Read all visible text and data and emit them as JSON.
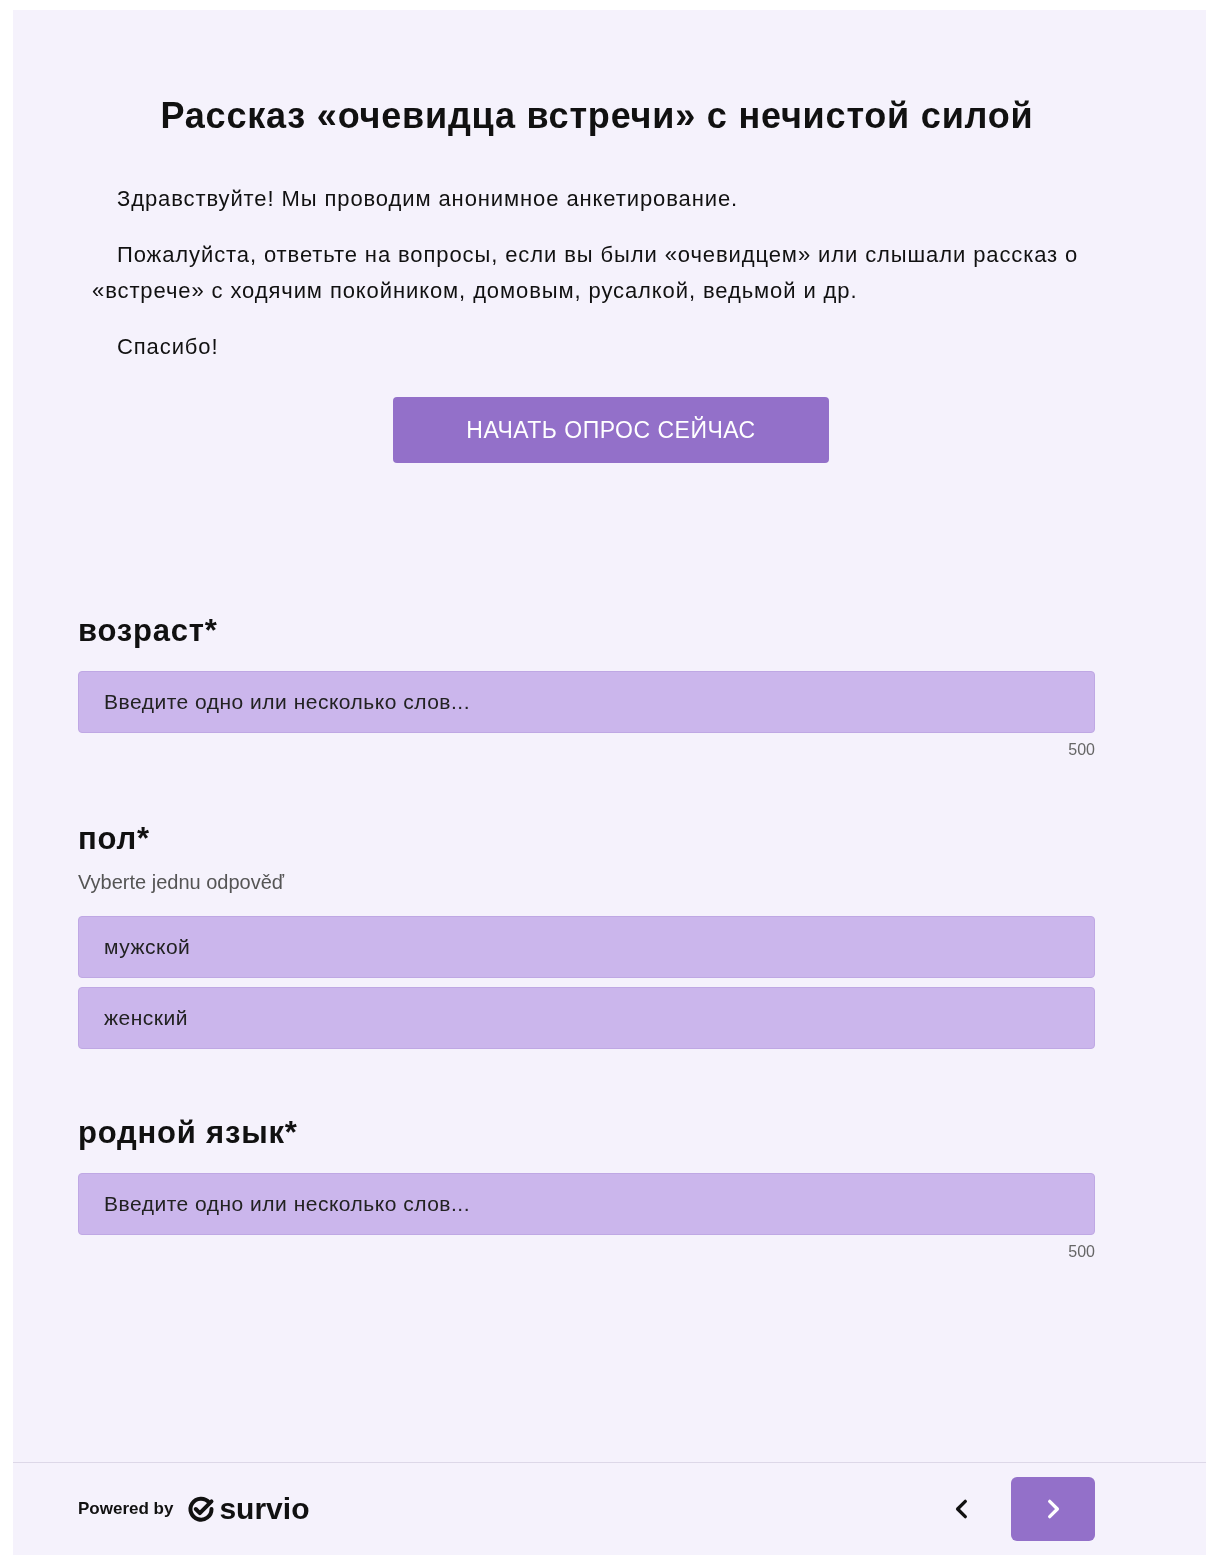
{
  "title": "Рассказ «очевидца встречи» с нечистой силой",
  "intro": [
    "Здравствуйте! Мы проводим анонимное анкетирование.",
    "Пожалуйста, ответьте на вопросы, если вы были «очевидцем» или слышали рассказ о «встрече» с ходячим покойником, домовым, русалкой, ведьмой и др.",
    "Спасибо!"
  ],
  "start_button": "НАЧАТЬ ОПРОС СЕЙЧАС",
  "questions": [
    {
      "kind": "text",
      "title": "возраст*",
      "placeholder": "Введите одно или несколько слов...",
      "counter": "500"
    },
    {
      "kind": "choice",
      "title": "пол*",
      "hint": "Vyberte jednu odpověď",
      "options": [
        {
          "label": "мужской",
          "selected": false
        },
        {
          "label": "женский",
          "selected": false
        }
      ]
    },
    {
      "kind": "text",
      "title": "родной язык*",
      "placeholder": "Введите одно или несколько слов...",
      "counter": "500"
    }
  ],
  "footer": {
    "powered_by": "Powered by",
    "brand": "survio"
  }
}
